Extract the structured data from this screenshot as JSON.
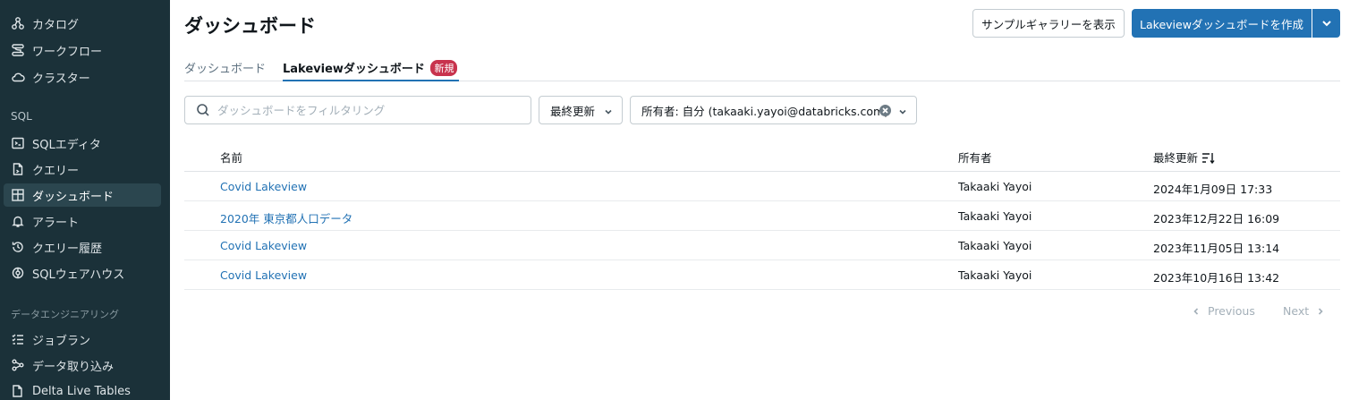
{
  "sidebar": {
    "items": [
      {
        "label": "カタログ",
        "icon": "catalog-icon"
      },
      {
        "label": "ワークフロー",
        "icon": "workflow-icon"
      },
      {
        "label": "クラスター",
        "icon": "cloud-icon"
      },
      {
        "label": "SQLエディタ",
        "icon": "sql-editor-icon"
      },
      {
        "label": "クエリー",
        "icon": "query-icon"
      },
      {
        "label": "ダッシュボード",
        "icon": "dashboard-icon"
      },
      {
        "label": "アラート",
        "icon": "bell-icon"
      },
      {
        "label": "クエリー履歴",
        "icon": "history-icon"
      },
      {
        "label": "SQLウェアハウス",
        "icon": "warehouse-icon"
      },
      {
        "label": "ジョブラン",
        "icon": "job-runs-icon"
      },
      {
        "label": "データ取り込み",
        "icon": "data-ingestion-icon"
      },
      {
        "label": "Delta Live Tables",
        "icon": "delta-live-tables-icon"
      }
    ],
    "section_sql": "SQL",
    "section_de": "データエンジニアリング",
    "active_item": "ダッシュボード"
  },
  "header": {
    "title": "ダッシュボード",
    "sample_gallery_label": "サンプルギャラリーを表示",
    "create_lakeview_label": "Lakeviewダッシュボードを作成"
  },
  "tabs": {
    "dashboards": "ダッシュボード",
    "lakeview": "Lakeviewダッシュボード",
    "new_badge": "新規"
  },
  "filters": {
    "search_placeholder": "ダッシュボードをフィルタリング",
    "sort_label": "最終更新",
    "owner_label": "所有者: 自分 (takaaki.yayoi@databricks.com)"
  },
  "table": {
    "columns": {
      "name": "名前",
      "owner": "所有者",
      "updated": "最終更新"
    },
    "rows": [
      {
        "name": "Covid Lakeview",
        "owner": "Takaaki Yayoi",
        "updated": "2024年1月09日 17:33"
      },
      {
        "name": "2020年 東京都人口データ",
        "owner": "Takaaki Yayoi",
        "updated": "2023年12月22日 16:09"
      },
      {
        "name": "Covid Lakeview",
        "owner": "Takaaki Yayoi",
        "updated": "2023年11月05日 13:14"
      },
      {
        "name": "Covid Lakeview",
        "owner": "Takaaki Yayoi",
        "updated": "2023年10月16日 13:42"
      }
    ]
  },
  "pagination": {
    "previous": "Previous",
    "next": "Next"
  },
  "colors": {
    "primary": "#2272b4",
    "sidebar_bg": "#1b3139",
    "badge": "#c8334d"
  }
}
